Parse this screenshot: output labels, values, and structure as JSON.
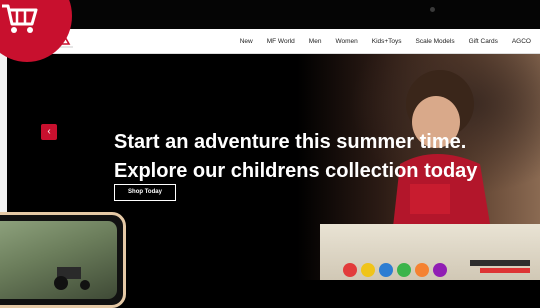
{
  "nav": {
    "items": [
      "New",
      "MF World",
      "Men",
      "Women",
      "Kids+Toys",
      "Scale Models",
      "Gift Cards",
      "AGCO"
    ]
  },
  "hero": {
    "headline_1": "Start an adventure this summer time.",
    "headline_2": "Explore our childrens collection today",
    "cta_label": "Shop Today",
    "prev_glyph": "‹"
  },
  "icons": {
    "cart": "cart-icon",
    "logo": "massey-ferguson-logo"
  },
  "colors": {
    "brand_red": "#c8102e",
    "nav_bg": "#ffffff",
    "hero_bg": "#000000"
  }
}
